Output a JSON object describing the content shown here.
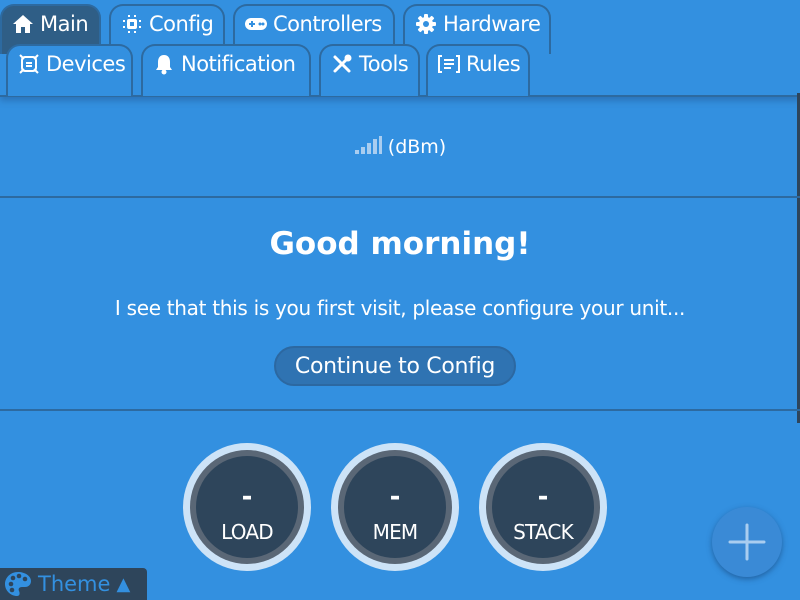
{
  "tabs": {
    "row1": [
      {
        "label": "Main",
        "icon": "home-icon",
        "active": true
      },
      {
        "label": "Config",
        "icon": "chip-icon",
        "active": false
      },
      {
        "label": "Controllers",
        "icon": "gamepad-icon",
        "active": false
      },
      {
        "label": "Hardware",
        "icon": "gear-icon",
        "active": false
      }
    ],
    "row2": [
      {
        "label": "Devices",
        "icon": "devices-icon",
        "active": false
      },
      {
        "label": "Notification",
        "icon": "bell-icon",
        "active": false
      },
      {
        "label": "Tools",
        "icon": "tools-icon",
        "active": false
      },
      {
        "label": "Rules",
        "icon": "rules-icon",
        "active": false
      }
    ]
  },
  "signal": {
    "icon": "signal-bars-icon",
    "text": "(dBm)"
  },
  "welcome": {
    "greeting": "Good morning!",
    "message": "I see that this is you first visit, please configure your unit...",
    "button_label": "Continue to Config"
  },
  "gauges": [
    {
      "value": "-",
      "label": "LOAD"
    },
    {
      "value": "-",
      "label": "MEM"
    },
    {
      "value": "-",
      "label": "STACK"
    }
  ],
  "theme": {
    "label": "Theme",
    "arrow": "▲"
  },
  "colors": {
    "background": "#3390e0",
    "dark": "#2e455b",
    "active_tab": "#2f5e86"
  }
}
